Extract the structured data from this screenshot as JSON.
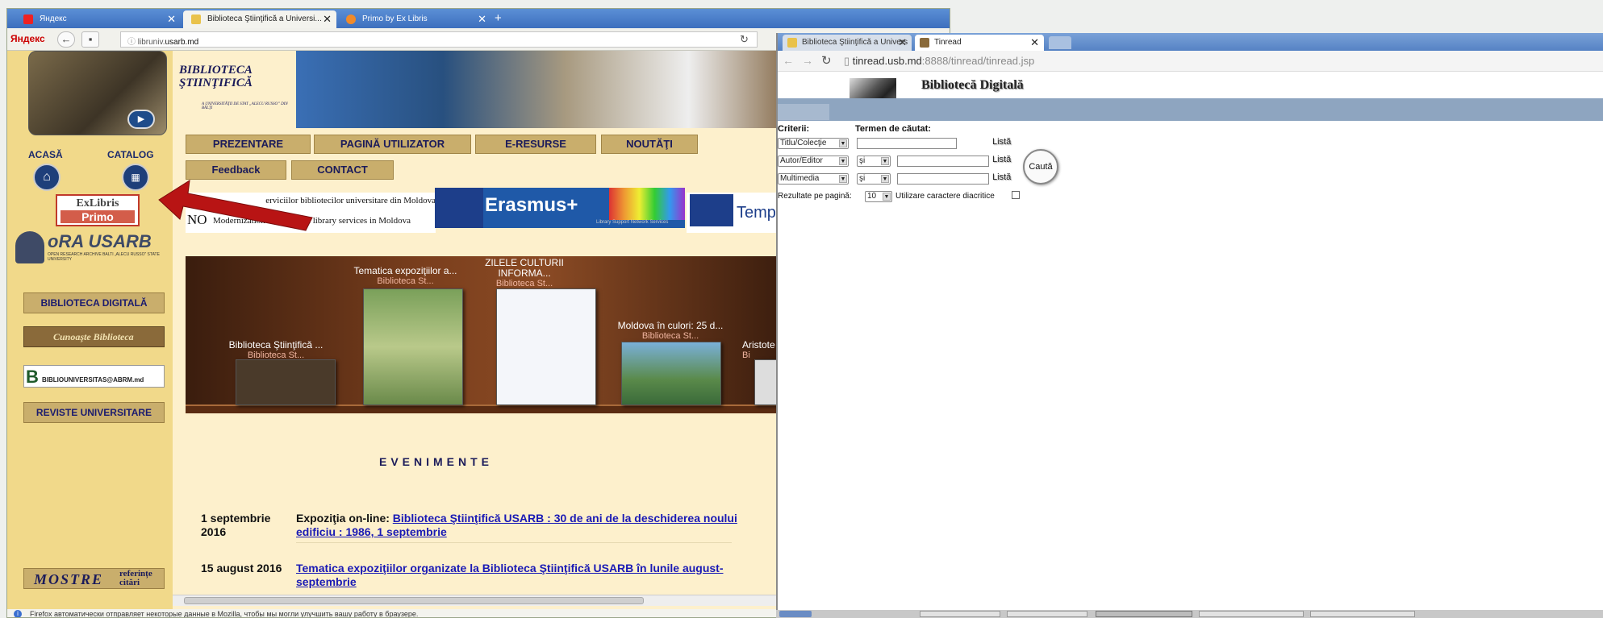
{
  "left_browser": {
    "tabs": [
      {
        "label": "Яндекс"
      },
      {
        "label": "Biblioteca Ştiinţifică a Universi..."
      },
      {
        "label": "Primo by Ex Libris"
      }
    ],
    "new_tab": "+",
    "yandex_logo": "Яндекс",
    "url_prefix": "libruniv.",
    "url_domain": "usarb.md",
    "status": "Firefox автоматически отправляет некоторые данные в Mozilla, чтобы мы могли улучшить вашу работу в браузере."
  },
  "site": {
    "logo_title": "BIBLIOTECA ŞTIINŢIFICĂ",
    "logo_sub": "A UNIVERSITĂŢII DE STAT „ALECU RUSSO” DIN BĂLŢI",
    "sidebar": {
      "acasa": "ACASĂ",
      "catalog": "CATALOG",
      "exlibris": "ExLibris",
      "primo": "Primo",
      "ora": "oRA USARB",
      "ora_sub": "OPEN RESEARCH ARCHIVE BALTI „ALECU RUSSO” STATE UNIVERSITY",
      "biblioteca_digitala": "BIBLIOTECA DIGITALĂ",
      "cunoaste": "Cunoaşte Biblioteca",
      "biblio_univ": "BIBLIOUNIVERSITAS@ABRM.md",
      "reviste": "REVISTE UNIVERSITARE",
      "mostre": "MOSTRE",
      "referinte": "referințe",
      "citari": "citări"
    },
    "menu": [
      "PREZENTARE",
      "PAGINĂ UTILIZATOR",
      "E-RESURSE",
      "NOUTĂŢI",
      "Feedback",
      "CONTACT"
    ],
    "banner_line1": "erviciilor bibliotecilor universitare din Moldova",
    "banner_no": "NO",
    "banner_line2": "Modernization of academic library services in Moldova",
    "erasmus": "Erasmus+",
    "erasmus_sub": "Library Support Network Services",
    "tempus": "Temp",
    "shelf": [
      {
        "title": "Biblioteca Ştiinţifică ...",
        "sub": "Biblioteca St..."
      },
      {
        "title": "Tematica expoziţiilor a...",
        "sub": "Biblioteca St..."
      },
      {
        "title": "ZILELE CULTURII INFORMA...",
        "sub": "Biblioteca St..."
      },
      {
        "title": "Moldova în culori: 25 d...",
        "sub": "Biblioteca St..."
      },
      {
        "title": "Aristote",
        "sub": "Bi"
      }
    ],
    "events_heading": "EVENIMENTE",
    "events": [
      {
        "date": "1 septembrie 2016",
        "prefix": "Expoziţia on-line: ",
        "link": "Biblioteca Ştiinţifică USARB : 30 de ani de la deschiderea noului edificiu : 1986, 1 septembrie"
      },
      {
        "date": "15 august 2016",
        "prefix": "",
        "link": "Tematica expoziţiilor organizate la Biblioteca Ştiinţifică USARB în lunile august-septembrie"
      }
    ]
  },
  "right_browser": {
    "tabs": [
      {
        "label": "Biblioteca Ştiinţifică a Univers"
      },
      {
        "label": "Tinread"
      }
    ],
    "url_host": "tinread.usb.md",
    "url_rest": ":8888/tinread/tinread.jsp",
    "page_title": "Bibliotecă Digitală",
    "criterii": "Criterii:",
    "termen": "Termen de căutat:",
    "rows": [
      {
        "criteria": "Titlu/Colecţie",
        "op": "",
        "lista": "Listă"
      },
      {
        "criteria": "Autor/Editor",
        "op": "şi",
        "lista": "Listă"
      },
      {
        "criteria": "Multimedia",
        "op": "şi",
        "lista": "Listă"
      }
    ],
    "search_button": "Caută",
    "results_label": "Rezultate pe pagină:",
    "results_value": "10",
    "diacritics_label": "Utilizare caractere diacritice"
  },
  "colors": {
    "accent_arrow": "#b81414",
    "menu_bg": "#c9ae6c",
    "link": "#1a1ab5"
  }
}
